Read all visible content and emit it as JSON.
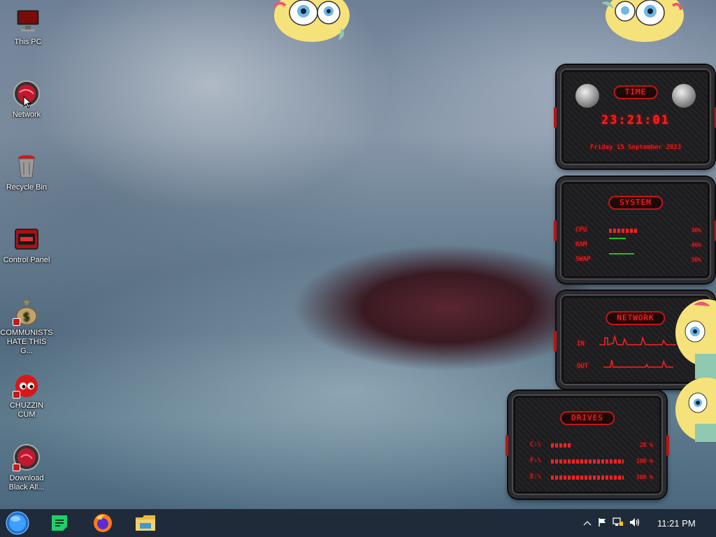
{
  "desktop": {
    "icons": [
      {
        "label": "This PC"
      },
      {
        "label": "Network"
      },
      {
        "label": "Recycle Bin"
      },
      {
        "label": "Control Panel"
      },
      {
        "label": "COMMUNISTS HATE THIS G..."
      },
      {
        "label": "CHUZZIN CUM"
      },
      {
        "label": "Download Black All..."
      }
    ]
  },
  "widgets": {
    "time": {
      "title": "TIME",
      "clock": "23:21:01",
      "date": "Friday 15 September 2023"
    },
    "system": {
      "title": "SYSTEM",
      "rows": [
        {
          "label": "CPU",
          "value": "36%"
        },
        {
          "label": "RAM",
          "value": "46%"
        },
        {
          "label": "SWAP",
          "value": "36%"
        }
      ]
    },
    "network": {
      "title": "NETWORK",
      "in_label": "IN",
      "out_label": "OUT"
    },
    "drives": {
      "title": "DRIVES",
      "rows": [
        {
          "label": "C:\\",
          "value": "28 %"
        },
        {
          "label": "F:\\",
          "value": "100 %"
        },
        {
          "label": "E:\\",
          "value": "100 %"
        }
      ]
    }
  },
  "taskbar": {
    "apps": [
      {
        "icon": "start-orb-icon"
      },
      {
        "icon": "notes-app-icon"
      },
      {
        "icon": "firefox-icon"
      },
      {
        "icon": "file-explorer-icon"
      }
    ],
    "tray": {
      "icons": [
        "chevron-up-icon",
        "flag-icon",
        "network-icon",
        "volume-icon"
      ],
      "clock": "11:21 PM"
    }
  },
  "colors": {
    "accent": "#ff2020",
    "taskbar": "#1c2634"
  }
}
